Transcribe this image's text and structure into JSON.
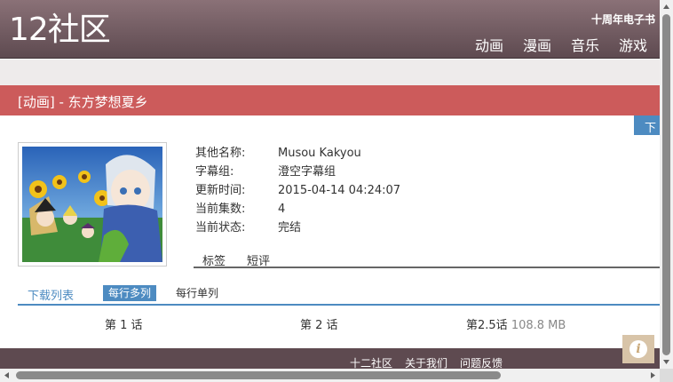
{
  "header": {
    "logo": "12社区",
    "promo": "十周年电子书",
    "nav": [
      "动画",
      "漫画",
      "音乐",
      "游戏"
    ]
  },
  "title": "[动画] - 东方梦想夏乡",
  "download_button": "下",
  "info": {
    "rows": [
      {
        "label": "其他名称:",
        "value": "Musou Kakyou"
      },
      {
        "label": "字幕组:",
        "value": "澄空字幕组"
      },
      {
        "label": "更新时间:",
        "value": "2015-04-14 04:24:07"
      },
      {
        "label": "当前集数:",
        "value": "4"
      },
      {
        "label": "当前状态:",
        "value": "完结"
      }
    ]
  },
  "tabs": [
    "标签",
    "短评"
  ],
  "downloads": {
    "title": "下载列表",
    "modes": [
      "每行多列",
      "每行单列"
    ],
    "episodes": [
      {
        "label": "第 1 话",
        "size": ""
      },
      {
        "label": "第 2 话",
        "size": ""
      },
      {
        "label": "第2.5话",
        "size": "108.8 MB"
      }
    ]
  },
  "footer": {
    "links": [
      "十二社区",
      "关于我们",
      "问题反馈"
    ]
  },
  "info_fab": "i",
  "colors": {
    "header": "#6f5a60",
    "title_bar": "#cc5b5b",
    "accent": "#4d8bc1",
    "footer": "#5e4a50"
  }
}
